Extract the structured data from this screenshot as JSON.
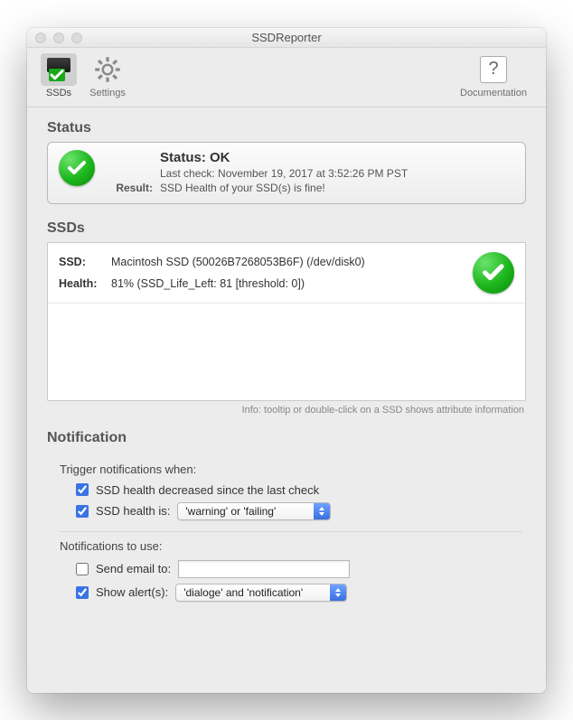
{
  "window": {
    "title": "SSDReporter"
  },
  "toolbar": {
    "ssds_label": "SSDs",
    "settings_label": "Settings",
    "documentation_label": "Documentation"
  },
  "sections": {
    "status": "Status",
    "ssds": "SSDs",
    "notification": "Notification"
  },
  "status": {
    "headline": "Status: OK",
    "last_check": "Last check: November 19, 2017 at 3:52:26 PM PST",
    "result_label": "Result:",
    "result_text": "SSD Health of your SSD(s) is fine!"
  },
  "ssd_list": {
    "labels": {
      "ssd": "SSD:",
      "health": "Health:"
    },
    "rows": [
      {
        "name": "Macintosh SSD (50026B7268053B6F)  (/dev/disk0)",
        "health": "81% (SSD_Life_Left: 81 [threshold: 0])",
        "status": "ok"
      }
    ],
    "info": "Info: tooltip or double-click on a SSD shows attribute information"
  },
  "notification": {
    "trigger_label": "Trigger notifications when:",
    "use_label": "Notifications to use:",
    "opts": {
      "decreased": {
        "checked": true,
        "label": "SSD health decreased since the last check"
      },
      "health_is": {
        "checked": true,
        "label": "SSD health is:",
        "select": "'warning' or 'failing'"
      },
      "send_email": {
        "checked": false,
        "label": "Send email to:",
        "value": ""
      },
      "show_alerts": {
        "checked": true,
        "label": "Show alert(s):",
        "select": "'dialoge' and 'notification'"
      }
    }
  }
}
